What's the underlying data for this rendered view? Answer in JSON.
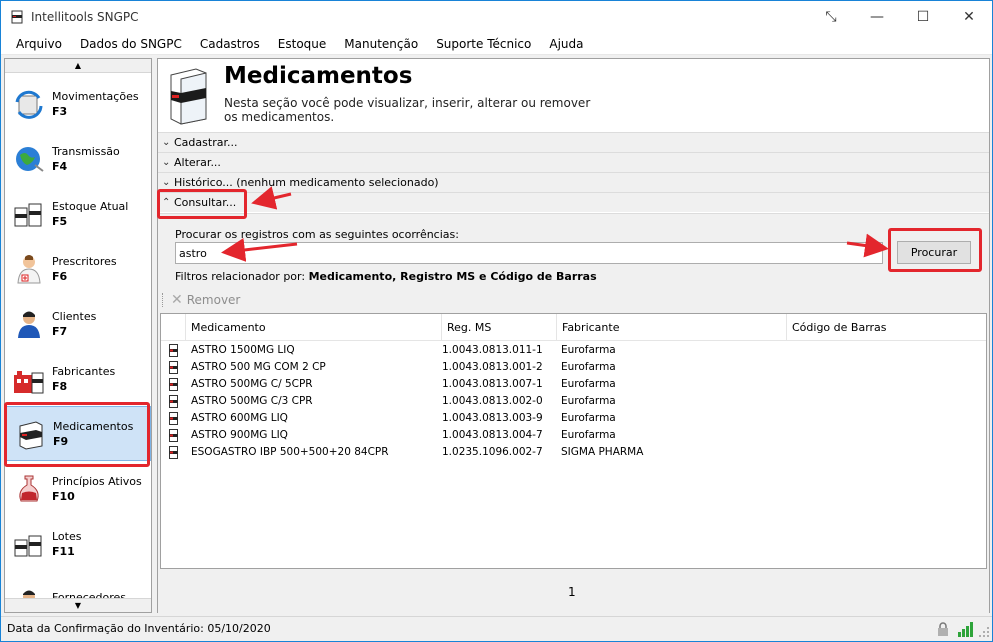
{
  "window": {
    "title": "Intellitools SNGPC",
    "controls": {
      "restore": "⤡",
      "minimize": "—",
      "maximize": "☐",
      "close": "✕"
    }
  },
  "menu": [
    "Arquivo",
    "Dados do SNGPC",
    "Cadastros",
    "Estoque",
    "Manutenção",
    "Suporte Técnico",
    "Ajuda"
  ],
  "sidebar": {
    "items": [
      {
        "label": "Movimentações",
        "key": "F3",
        "icon": "movements-icon"
      },
      {
        "label": "Transmissão",
        "key": "F4",
        "icon": "globe-icon"
      },
      {
        "label": "Estoque Atual",
        "key": "F5",
        "icon": "stock-boxes-icon"
      },
      {
        "label": "Prescritores",
        "key": "F6",
        "icon": "doctor-icon"
      },
      {
        "label": "Clientes",
        "key": "F7",
        "icon": "client-icon"
      },
      {
        "label": "Fabricantes",
        "key": "F8",
        "icon": "factory-icon"
      },
      {
        "label": "Medicamentos",
        "key": "F9",
        "icon": "medicine-box-icon",
        "active": true
      },
      {
        "label": "Princípios Ativos",
        "key": "F10",
        "icon": "flask-icon"
      },
      {
        "label": "Lotes",
        "key": "F11",
        "icon": "lots-icon"
      },
      {
        "label": "Fornecedores",
        "key": "",
        "icon": "supplier-icon"
      }
    ]
  },
  "header": {
    "title": "Medicamentos",
    "description": "Nesta seção você pode visualizar, inserir, alterar ou remover os medicamentos."
  },
  "sections": {
    "cadastrar": "Cadastrar...",
    "alterar": "Alterar...",
    "historico": "Histórico... (nenhum medicamento selecionado)",
    "consultar": "Consultar..."
  },
  "search": {
    "label": "Procurar os registros com as seguintes ocorrências:",
    "value": "astro",
    "button": "Procurar",
    "filters_prefix": "Filtros relacionador por:",
    "filters_value": "Medicamento, Registro MS e Código de Barras"
  },
  "toolbar": {
    "remove": "Remover"
  },
  "table": {
    "columns": [
      "Medicamento",
      "Reg. MS",
      "Fabricante",
      "Código de Barras"
    ],
    "rows": [
      {
        "medicamento": "ASTRO 1500MG LIQ",
        "reg": "1.0043.0813.011-1",
        "fabricante": "Eurofarma",
        "codigo": ""
      },
      {
        "medicamento": "ASTRO 500 MG COM 2 CP",
        "reg": "1.0043.0813.001-2",
        "fabricante": "Eurofarma",
        "codigo": ""
      },
      {
        "medicamento": "ASTRO 500MG C/ 5CPR",
        "reg": "1.0043.0813.007-1",
        "fabricante": "Eurofarma",
        "codigo": ""
      },
      {
        "medicamento": "ASTRO 500MG C/3 CPR",
        "reg": "1.0043.0813.002-0",
        "fabricante": "Eurofarma",
        "codigo": ""
      },
      {
        "medicamento": "ASTRO 600MG LIQ",
        "reg": "1.0043.0813.003-9",
        "fabricante": "Eurofarma",
        "codigo": ""
      },
      {
        "medicamento": "ASTRO 900MG LIQ",
        "reg": "1.0043.0813.004-7",
        "fabricante": "Eurofarma",
        "codigo": ""
      },
      {
        "medicamento": "ESOGASTRO IBP 500+500+20 84CPR",
        "reg": "1.0235.1096.002-7",
        "fabricante": "SIGMA PHARMA",
        "codigo": ""
      }
    ]
  },
  "pager": {
    "page": "1"
  },
  "status": {
    "text": "Data da Confirmação do Inventário: 05/10/2020"
  },
  "colors": {
    "highlight": "#e3262d",
    "accent": "#1883d7",
    "active_item": "#cfe3f7"
  }
}
